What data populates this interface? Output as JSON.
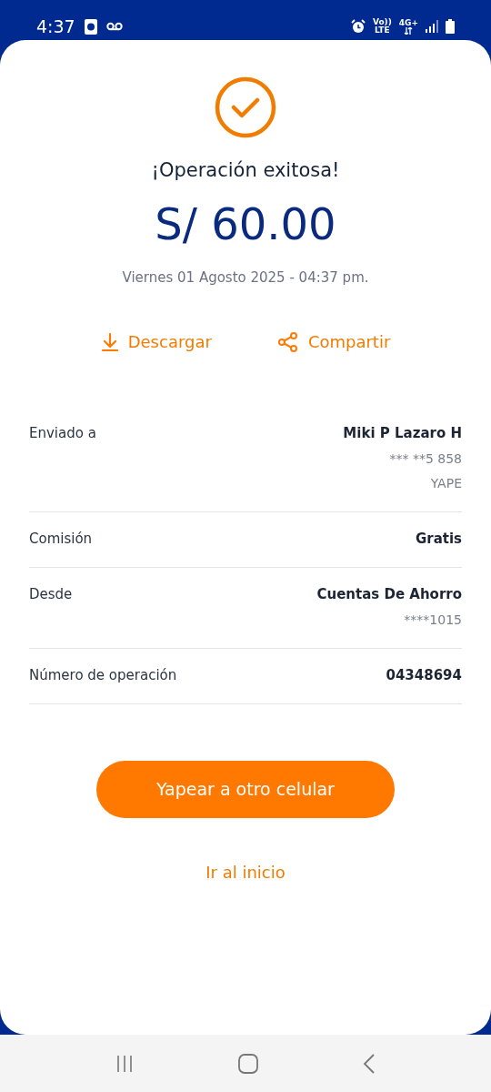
{
  "status_bar": {
    "time": "4:37",
    "volte_top": "Vo))",
    "volte_bottom": "LTE",
    "network": "4G+"
  },
  "title": "¡Operación exitosa!",
  "amount": "S/ 60.00",
  "date": "Viernes 01 Agosto 2025 - 04:37 pm.",
  "actions": [
    {
      "kind": "download",
      "label": "Descargar"
    },
    {
      "kind": "share",
      "label": "Compartir"
    }
  ],
  "details": [
    {
      "label": "Enviado a",
      "value": "Miki P Lazaro H",
      "sub": [
        "*** **5 858",
        "YAPE"
      ]
    },
    {
      "label": "Comisión",
      "value": "Gratis"
    },
    {
      "label": "Desde",
      "value": "Cuentas De Ahorro",
      "sub": [
        "****1015"
      ]
    },
    {
      "label": "Número de operación",
      "value": "04348694"
    }
  ],
  "primary_button": "Yapear a otro celular",
  "link": "Ir al inicio"
}
